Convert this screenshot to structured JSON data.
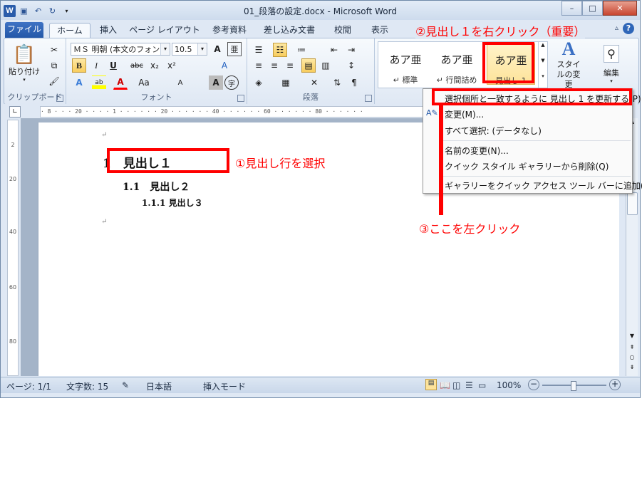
{
  "window": {
    "title": "01_段落の設定.docx - Microsoft Word"
  },
  "titlebar": {
    "word_icon": "W",
    "minimize": "–",
    "maximize": "□",
    "close": "✕"
  },
  "tabs": [
    "ファイル",
    "ホーム",
    "挿入",
    "ページ レイアウト",
    "参考資料",
    "差し込み文書",
    "校閲",
    "表示"
  ],
  "ribbon": {
    "clipboard": {
      "paste_label": "貼り付け",
      "group_label": "クリップボード"
    },
    "font": {
      "font_name": "ＭＳ 明朝 (本文のフォン",
      "font_size": "10.5",
      "group_label": "フォント",
      "bold": "B",
      "italic": "I",
      "underline": "U",
      "strike": "abc",
      "sub": "x₂",
      "sup": "x²",
      "color_a": "A",
      "aa": "Aa",
      "grow": "A",
      "shrink": "A",
      "clear": "A",
      "phonetic": "亜",
      "enclose": "字"
    },
    "paragraph": {
      "group_label": "段落"
    },
    "styles": {
      "items": [
        {
          "preview": "あア亜",
          "name": "↵ 標準"
        },
        {
          "preview": "あア亜",
          "name": "↵ 行間詰め"
        },
        {
          "preview": "あア亜",
          "name": "見出し 1"
        }
      ],
      "change_label": "スタイルの変更",
      "edit_label": "編集"
    }
  },
  "ruler": {
    "text": "· 8 · · · 20 · · · · 1 · · · · · · 20 · · · · · · 40 · · · · · · 60 · · · · · · 80 · · · · · ·"
  },
  "vruler": [
    "2",
    "20",
    "40",
    "60",
    "80"
  ],
  "document": {
    "h1": "1　見出し１",
    "h2": "1.1　見出し２",
    "h3": "1.1.1 見出し３",
    "para_mark": "↵"
  },
  "context_menu": {
    "items": [
      "選択個所と一致するように 見出し 1 を更新する(P)",
      "変更(M)...",
      "すべて選択: (データなし)",
      "名前の変更(N)...",
      "クイック スタイル ギャラリーから削除(Q)",
      "ギャラリーをクイック アクセス ツール バーに追加(A)"
    ]
  },
  "status": {
    "page": "ページ: 1/1",
    "words": "文字数: 15",
    "lang": "日本語",
    "mode": "挿入モード",
    "zoom": "100%"
  },
  "annotations": {
    "step1": "①見出し行を選択",
    "step2": "②見出し１を右クリック（重要）",
    "step3": "③ここを左クリック"
  },
  "colors": {
    "annotation_red": "#ff0000",
    "file_tab": "#2458a8",
    "highlight": "#fde39a"
  }
}
